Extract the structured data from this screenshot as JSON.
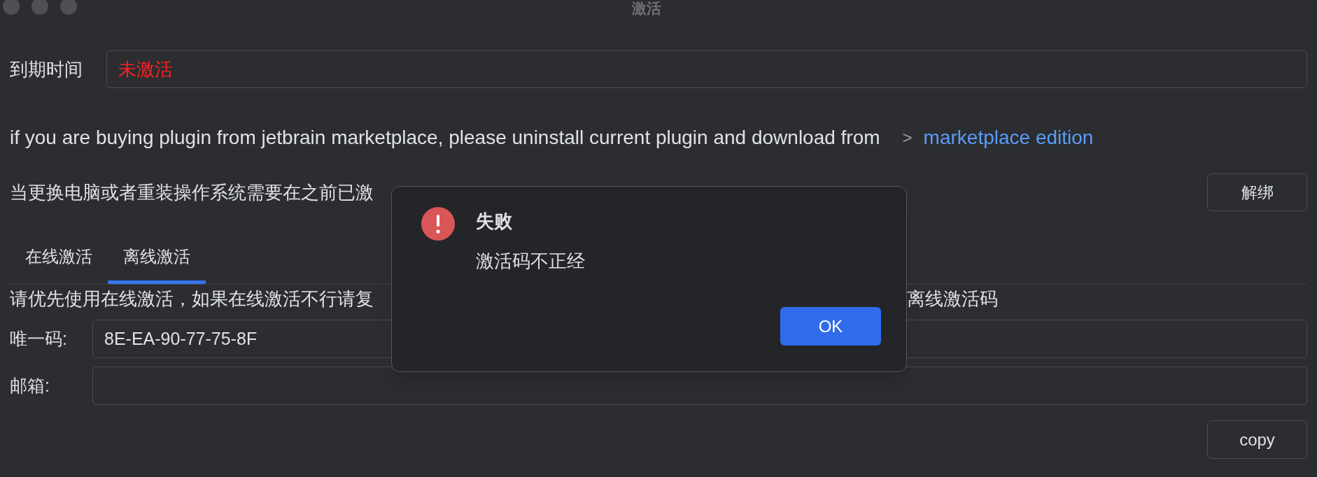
{
  "window": {
    "title": "激活"
  },
  "expiry": {
    "label": "到期时间",
    "value": "未激活"
  },
  "marketplace": {
    "text": "if you are buying plugin from jetbrain marketplace, please uninstall current plugin and download from",
    "arrow": ">",
    "link": "marketplace edition"
  },
  "unbind": {
    "text": "当更换电脑或者重装操作系统需要在之前已激",
    "button": "解绑"
  },
  "tabs": [
    {
      "label": "在线激活",
      "selected": false
    },
    {
      "label": "离线激活",
      "selected": true
    }
  ],
  "offline": {
    "instruction_start": "请优先使用在线激活，如果在线激活不行请复",
    "instruction_end": "离线激活码",
    "fields": [
      {
        "label": "唯一码:",
        "value": "8E-EA-90-77-75-8F"
      },
      {
        "label": "邮箱:"
      }
    ],
    "copy_button": "copy"
  },
  "dialog": {
    "title": "失败",
    "message": "激活码不正经",
    "button": "OK"
  }
}
